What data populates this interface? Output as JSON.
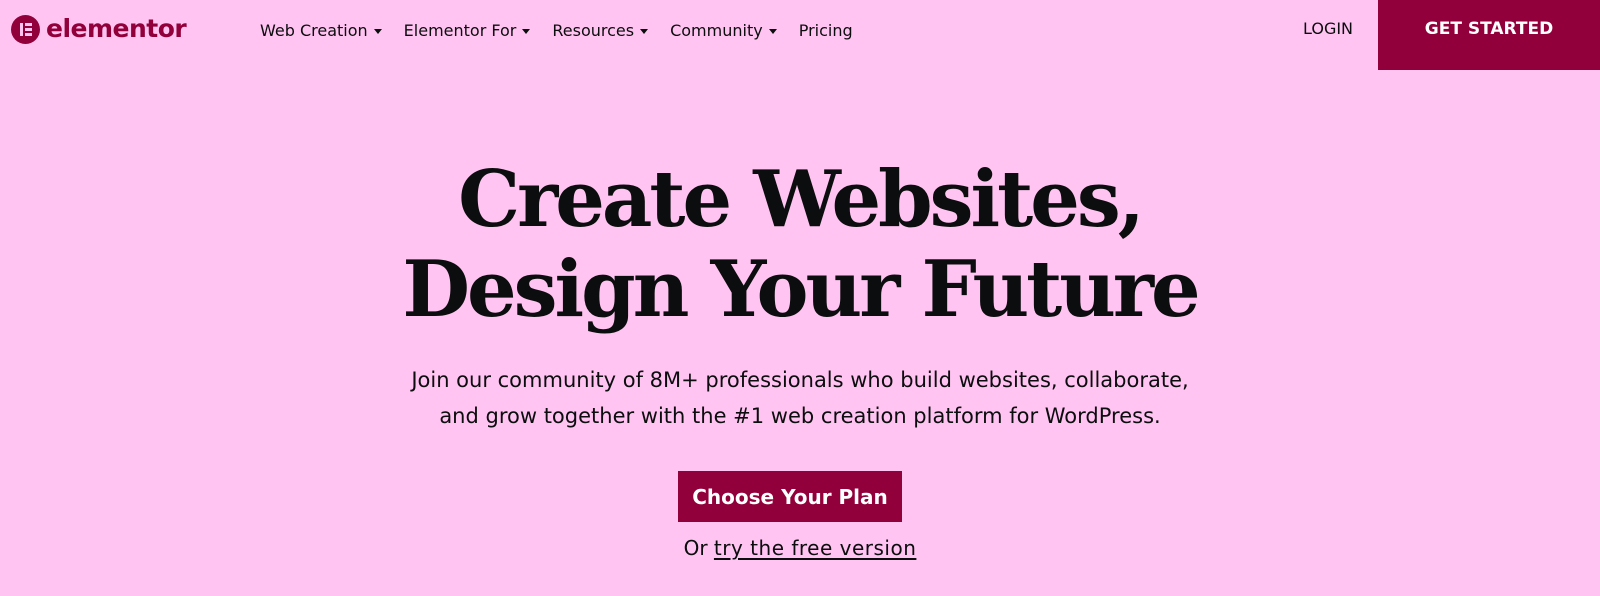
{
  "brand": {
    "name": "elementor",
    "primary_color": "#92003b",
    "background_color": "#ffc4f1"
  },
  "nav": {
    "items": [
      {
        "label": "Web Creation",
        "has_dropdown": true
      },
      {
        "label": "Elementor For",
        "has_dropdown": true
      },
      {
        "label": "Resources",
        "has_dropdown": true
      },
      {
        "label": "Community",
        "has_dropdown": true
      },
      {
        "label": "Pricing",
        "has_dropdown": false
      }
    ],
    "login_label": "LOGIN",
    "get_started_label": "GET STARTED"
  },
  "hero": {
    "title_line1": "Create Websites,",
    "title_line2": "Design Your Future",
    "subtitle_line1": "Join our community of 8M+ professionals who build websites, collaborate,",
    "subtitle_line2": "and grow together with the #1 web creation platform for WordPress.",
    "cta_label": "Choose Your Plan",
    "free_prefix": "Or",
    "free_link_label": "try the free version"
  }
}
